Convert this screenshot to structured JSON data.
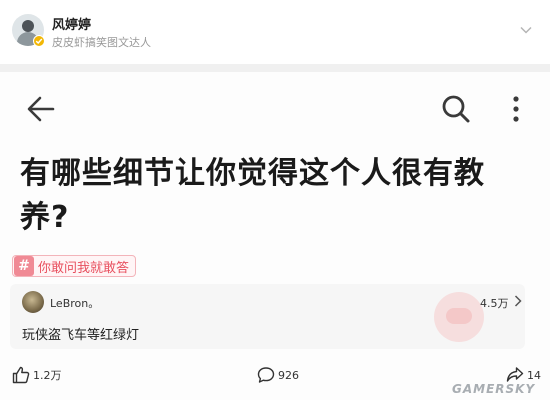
{
  "author": {
    "name": "风婷婷",
    "description": "皮皮虾搞笑图文达人",
    "badge_color": "#f2b705"
  },
  "header": {
    "icons": [
      "back-arrow-icon",
      "search-icon",
      "more-vertical-icon"
    ]
  },
  "question": {
    "title": "有哪些细节让你觉得这个人很有教养?"
  },
  "topic": {
    "hash": "#",
    "label": "你敢问我就敢答",
    "accent": "#e8505f"
  },
  "answer": {
    "author": "LeBron。",
    "likes": "4.5万",
    "text": "玩侠盗飞车等红绿灯"
  },
  "actions": {
    "like_count": "1.2万",
    "comment_count": "926",
    "share_count": "14"
  },
  "watermark": {
    "site": "GAMERSKY"
  }
}
